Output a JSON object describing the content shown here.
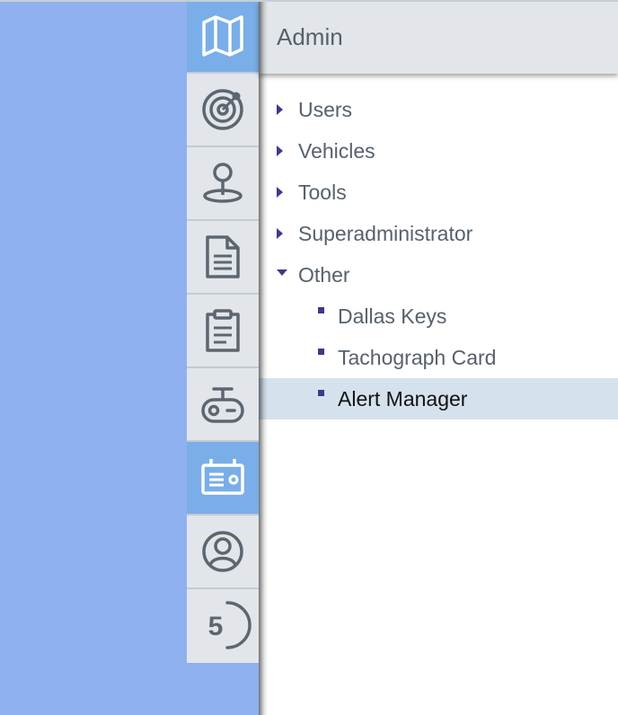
{
  "rail": {
    "items": [
      {
        "icon": "map-icon",
        "active": true
      },
      {
        "icon": "radar-icon",
        "active": false
      },
      {
        "icon": "location-pin-icon",
        "active": false
      },
      {
        "icon": "document-icon",
        "active": false
      },
      {
        "icon": "clipboard-icon",
        "active": false
      },
      {
        "icon": "remote-control-icon",
        "active": false
      },
      {
        "icon": "admin-card-icon",
        "active": true
      },
      {
        "icon": "user-icon",
        "active": false
      },
      {
        "icon": "counter-icon",
        "active": false
      }
    ],
    "counter_value": "5"
  },
  "panel": {
    "title": "Admin",
    "tree": [
      {
        "label": "Users",
        "expanded": false
      },
      {
        "label": "Vehicles",
        "expanded": false
      },
      {
        "label": "Tools",
        "expanded": false
      },
      {
        "label": "Superadministrator",
        "expanded": false
      },
      {
        "label": "Other",
        "expanded": true,
        "children": [
          {
            "label": "Dallas Keys",
            "selected": false
          },
          {
            "label": "Tachograph Card",
            "selected": false
          },
          {
            "label": "Alert Manager",
            "selected": true
          }
        ]
      }
    ]
  },
  "colors": {
    "map_background": "#8fb1f0",
    "rail_background": "#e2e6ea",
    "rail_active": "#7aaee8",
    "icon_gray": "#5d6670",
    "selected_row": "#d5e2ee",
    "tree_marker": "#3e3a8a"
  }
}
